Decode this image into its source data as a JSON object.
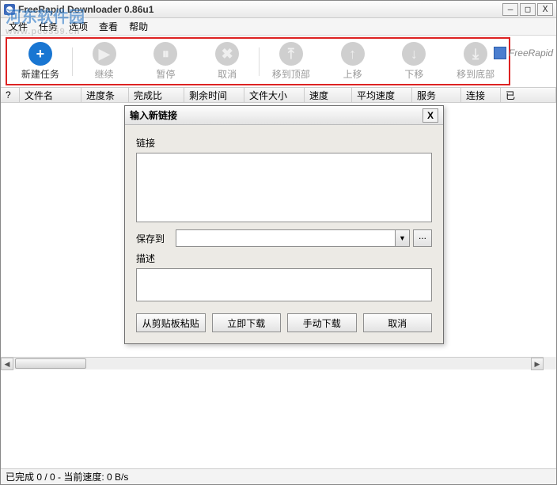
{
  "window": {
    "title": "FreeRapid Downloader 0.86u1"
  },
  "watermark": {
    "line1": "河东软件园",
    "line2": "www.pc0359.cn"
  },
  "window_buttons": {
    "min": "—",
    "max": "□",
    "close": "X"
  },
  "menu": {
    "file": "文件",
    "tasks": "任务",
    "options": "选项",
    "view": "查看",
    "help": "帮助"
  },
  "toolbar": {
    "items": [
      {
        "label": "新建任务",
        "glyph": "+",
        "enabled": true
      },
      {
        "label": "继续",
        "glyph": "▶",
        "enabled": false
      },
      {
        "label": "暂停",
        "glyph": "⏸",
        "enabled": false
      },
      {
        "label": "取消",
        "glyph": "✖",
        "enabled": false
      },
      {
        "label": "移到顶部",
        "glyph": "⤒",
        "enabled": false
      },
      {
        "label": "上移",
        "glyph": "↑",
        "enabled": false
      },
      {
        "label": "下移",
        "glyph": "↓",
        "enabled": false
      },
      {
        "label": "移到底部",
        "glyph": "⤓",
        "enabled": false
      }
    ]
  },
  "search_placeholder": "FreeRapid",
  "columns": {
    "c0": "?",
    "c1": "文件名",
    "c2": "进度条",
    "c3": "完成比",
    "c4": "剩余时间",
    "c5": "文件大小",
    "c6": "速度",
    "c7": "平均速度",
    "c8": "服务",
    "c9": "连接",
    "c10": "已"
  },
  "dialog": {
    "title": "输入新链接",
    "link_label": "链接",
    "saveto_label": "保存到",
    "saveto_value": "",
    "browse_label": "...",
    "desc_label": "描述",
    "btn_paste": "从剪贴板粘贴",
    "btn_now": "立即下载",
    "btn_manual": "手动下载",
    "btn_cancel": "取消"
  },
  "status": {
    "text": "已完成 0 / 0 - 当前速度: 0 B/s"
  }
}
